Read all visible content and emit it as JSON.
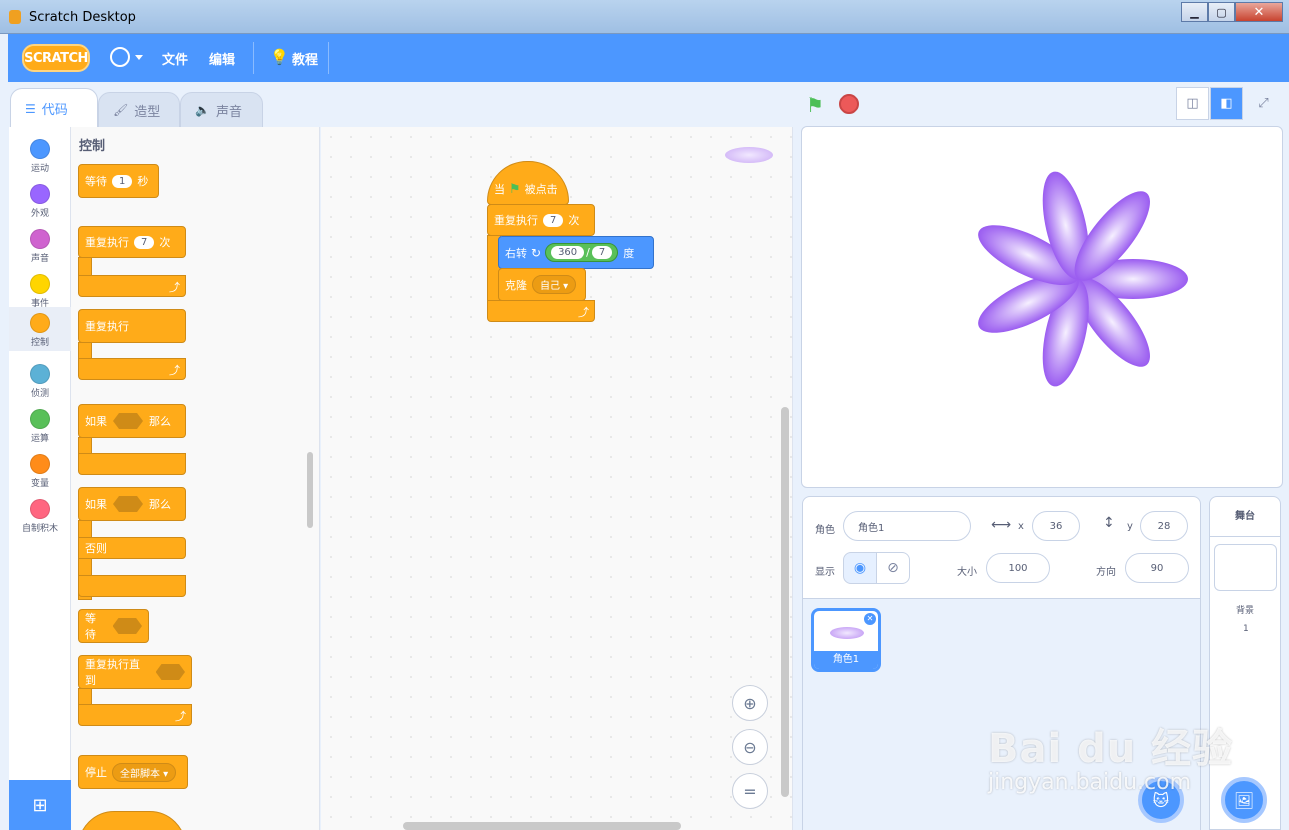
{
  "window": {
    "title": "Scratch Desktop"
  },
  "menu": {
    "logo": "SCRATCH",
    "file": "文件",
    "edit": "编辑",
    "tutorials": "教程"
  },
  "tabs": [
    {
      "label": "代码",
      "icon": "code-icon"
    },
    {
      "label": "造型",
      "icon": "brush-icon"
    },
    {
      "label": "声音",
      "icon": "speaker-icon"
    }
  ],
  "categories": [
    {
      "label": "运动",
      "color": "#4c97ff"
    },
    {
      "label": "外观",
      "color": "#9966ff"
    },
    {
      "label": "声音",
      "color": "#cf63cf"
    },
    {
      "label": "事件",
      "color": "#ffd500"
    },
    {
      "label": "控制",
      "color": "#ffab19"
    },
    {
      "label": "侦测",
      "color": "#5cb1d6"
    },
    {
      "label": "运算",
      "color": "#59c059"
    },
    {
      "label": "变量",
      "color": "#ff8c1a"
    },
    {
      "label": "自制积木",
      "color": "#ff6680"
    }
  ],
  "palette": {
    "title": "控制",
    "wait": {
      "label": "等待",
      "value": "1",
      "unit": "秒"
    },
    "repeat": {
      "label": "重复执行",
      "value": "7",
      "unit": "次"
    },
    "forever": {
      "label": "重复执行"
    },
    "if_then": {
      "if": "如果",
      "then": "那么"
    },
    "if_else": {
      "if": "如果",
      "then": "那么",
      "else": "否则"
    },
    "wait_until": {
      "label": "等待"
    },
    "repeat_until": {
      "label": "重复执行直到"
    },
    "stop": {
      "label": "停止",
      "option": "全部脚本"
    }
  },
  "script": {
    "hat": {
      "when": "当",
      "clicked": "被点击"
    },
    "repeat": {
      "label": "重复执行",
      "value": "7",
      "unit": "次"
    },
    "turn": {
      "label": "右转",
      "left": "360",
      "op": "/",
      "right": "7",
      "unit": "度"
    },
    "clone": {
      "label": "克隆",
      "option": "自己"
    }
  },
  "sprite_info": {
    "sprite_label": "角色",
    "sprite_name": "角色1",
    "x_label": "x",
    "x": "36",
    "y_label": "y",
    "y": "28",
    "show_label": "显示",
    "size_label": "大小",
    "size": "100",
    "direction_label": "方向",
    "direction": "90"
  },
  "sprites": [
    {
      "name": "角色1"
    }
  ],
  "stage_panel": {
    "title": "舞台",
    "backdrops_label": "背景",
    "backdrops_count": "1"
  },
  "watermark": {
    "brand": "Bai du 经验",
    "url": "jingyan.baidu.com"
  },
  "colors": {
    "menu_blue": "#4c97ff",
    "control_orange": "#ffab19",
    "petal_purple": "#9a5cf0"
  }
}
